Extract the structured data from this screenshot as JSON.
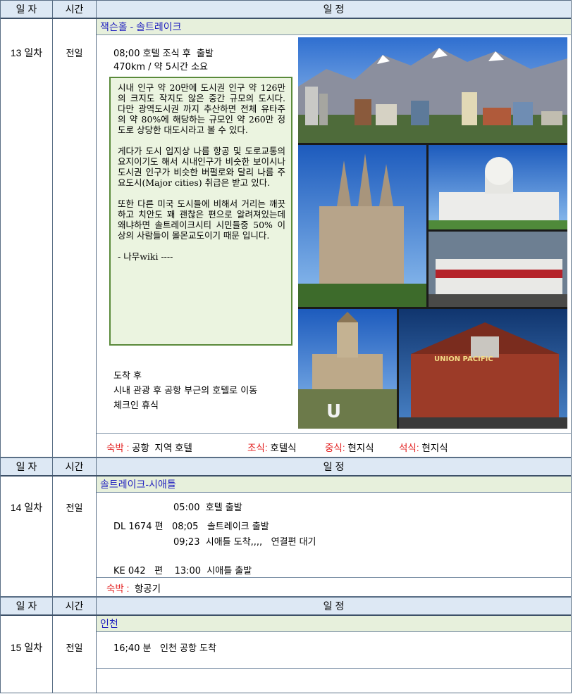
{
  "header": {
    "day": "일 자",
    "time": "시간",
    "schedule": "일 정"
  },
  "days": [
    {
      "day_label": "13 일차",
      "time_label": "전일",
      "route": "잭슨홀 - 솔트레이크",
      "lines": [
        "08;00 호텔 조식 후  출발",
        "470km / 약 5시간 소요"
      ],
      "info": [
        "시내 인구 약 20만에 도시권 인구 약 126만의 크지도 작지도 않은 중간 규모의 도시다. 다만 광역도시권 까지 추산하면 전체 유타주의 약 80%에 해당하는 규모인 약 260만 정도로 상당한 대도시라고 볼 수 있다.",
        "게다가 도시 입지상 나름 항공 및 도로교통의 요지이기도 해서 시내인구가 비슷한 보이시나 도시권 인구가 비슷한 버펄로와 달리 나름 주요도시(Major cities) 취급은 받고 있다.",
        "또한 다른 미국 도시들에 비해서 거리는 깨끗하고 치안도 꽤 괜찮은 편으로 알려져있는데 왜냐하면 솔트레이크시티 시민들중 50% 이상의 사람들이 몰몬교도이기 때문 입니다.",
        "- 나무wiki ----"
      ],
      "arrival_lines": [
        "도착 후",
        "시내 관광 후 공항 부근의 호텔로 이동",
        "체크인 휴식"
      ],
      "lodging_label": "숙박 :",
      "lodging_value": " 공항  지역 호텔",
      "breakfast_label": "조식:",
      "breakfast_value": " 호텔식",
      "lunch_label": "중식:",
      "lunch_value": " 현지식",
      "dinner_label": "석식:",
      "dinner_value": " 현지식"
    },
    {
      "day_label": "14 일차",
      "time_label": "전일",
      "route": "솔트레이크-시애틀",
      "lines": [
        "05:00  호텔 출발",
        "DL 1674 편   08;05   솔트레이크 출발",
        "09;23  시애틀 도착,,,,   연결편 대기",
        "KE 042   편    13:00  시애틀 출발"
      ],
      "lodging_label": "숙박 :",
      "lodging_value": "  항공기"
    },
    {
      "day_label": "15 일차",
      "time_label": "전일",
      "route": "인천",
      "lines": [
        "16;40 분   인천 공항 도착"
      ]
    }
  ],
  "photo_labels": {
    "union_pacific": "UNION PACIFIC"
  },
  "colors": {
    "header_bg": "#dde8f4",
    "title_bg": "#e7f0dc",
    "route_text": "#1f1fbf",
    "accent_red": "#e21b1b",
    "info_bg": "#ebf4e0",
    "info_border": "#5a8a3a"
  }
}
